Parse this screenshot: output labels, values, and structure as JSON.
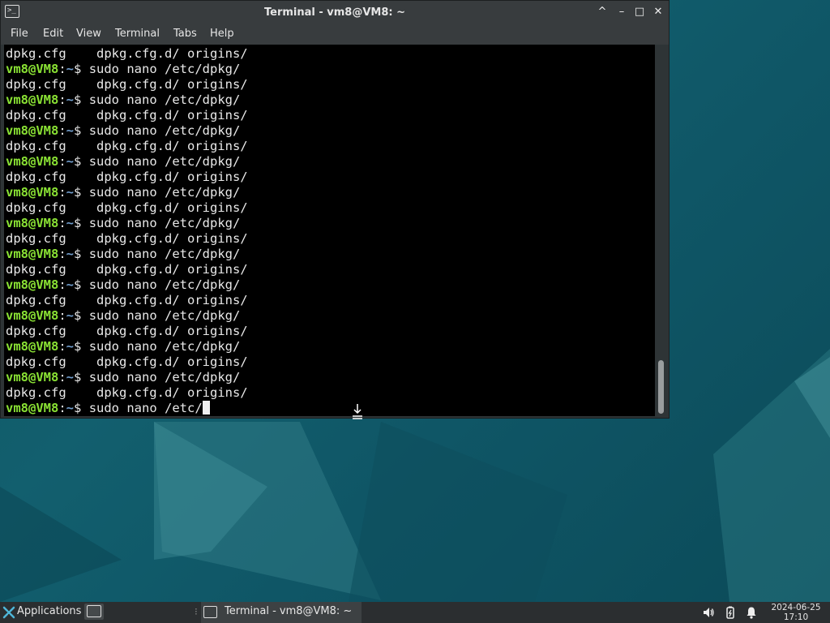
{
  "window": {
    "title": "Terminal - vm8@VM8: ~",
    "minimize_glyph": "–",
    "maximize_glyph": "□",
    "close_glyph": "✕",
    "shade_glyph": "^"
  },
  "menu": [
    "File",
    "Edit",
    "View",
    "Terminal",
    "Tabs",
    "Help"
  ],
  "terminal": {
    "prompt_user": "vm8@VM8",
    "prompt_sep": ":",
    "prompt_path": "~",
    "prompt_symbol": "$",
    "listing": "dpkg.cfg    dpkg.cfg.d/ origins/",
    "command": "sudo nano /etc/dpkg/",
    "current_input": "sudo nano /etc/"
  },
  "taskbar": {
    "applications_label": "Applications",
    "task_label": "Terminal - vm8@VM8: ~",
    "date": "2024-06-25",
    "time": "17:10"
  }
}
